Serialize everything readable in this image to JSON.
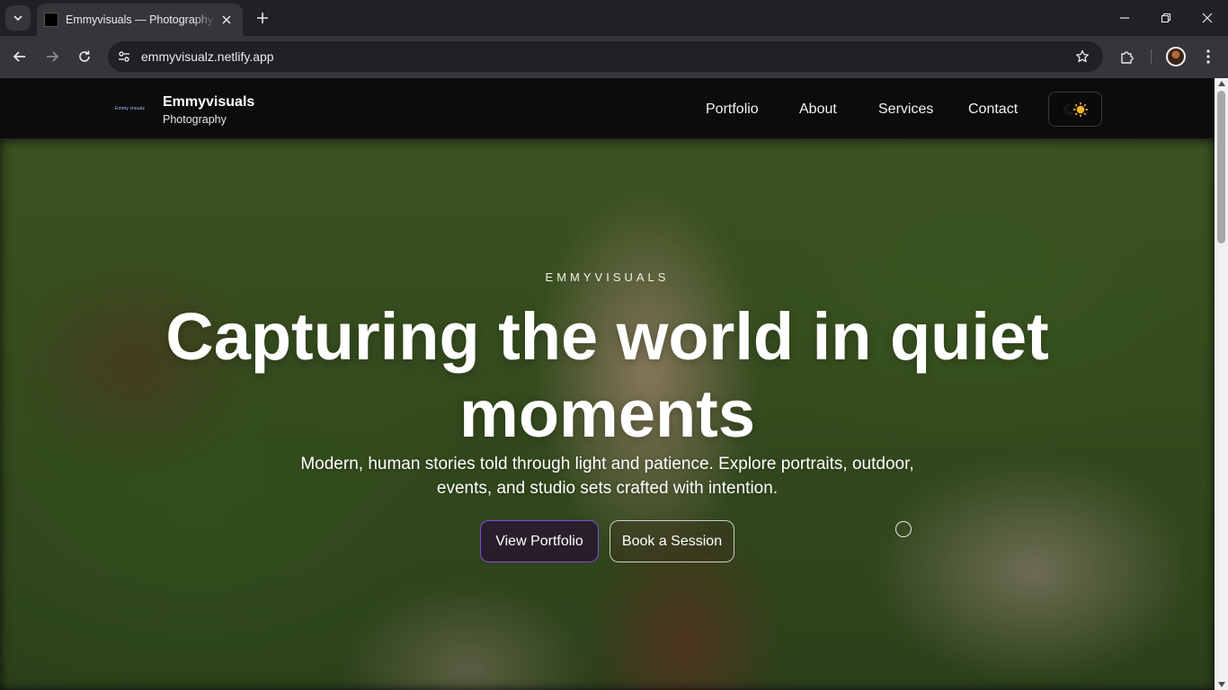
{
  "browser": {
    "tab_title": "Emmyvisuals — Photography Portfolio",
    "url": "emmyvisualz.netlify.app"
  },
  "nav": {
    "logo_text": "Emmy visualz",
    "brand_name": "Emmyvisuals",
    "brand_sub": "Photography",
    "links": [
      "Portfolio",
      "About",
      "Services",
      "Contact"
    ],
    "theme_icons": [
      "moon-icon",
      "sun-icon"
    ]
  },
  "hero": {
    "eyebrow": "EMMYVISUALS",
    "headline": "Capturing the world in quiet moments",
    "subcopy": "Modern, human stories told through light and patience. Explore portraits, outdoor, events, and studio sets crafted with intention.",
    "primary_cta": "View Portfolio",
    "secondary_cta": "Book a Session"
  },
  "colors": {
    "chrome_dark": "#202124",
    "chrome_toolbar": "#35363a",
    "navbar_bg": "#0c0c0c",
    "accent_purple": "#7c4dd8",
    "sun_yellow": "#f5b62a"
  }
}
